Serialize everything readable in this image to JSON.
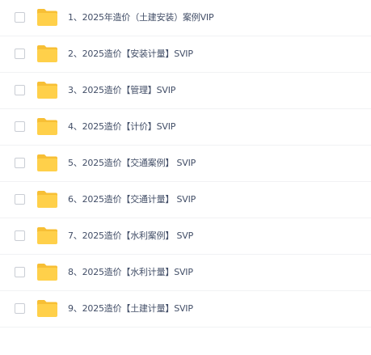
{
  "colors": {
    "folder": "#ffd04a",
    "folder_tab": "#f7bf35",
    "text": "#424e67",
    "divider": "#f1f2f4",
    "checkbox_border": "#c9cdd4"
  },
  "files": [
    {
      "name": "1、2025年造价（土建安装）案例VIP",
      "icon": "folder-icon"
    },
    {
      "name": "2、2025造价【安装计量】SVIP",
      "icon": "folder-icon"
    },
    {
      "name": "3、2025造价【管理】SVIP",
      "icon": "folder-icon"
    },
    {
      "name": "4、2025造价【计价】SVIP",
      "icon": "folder-icon"
    },
    {
      "name": "5、2025造价【交通案例】 SVIP",
      "icon": "folder-icon"
    },
    {
      "name": "6、2025造价【交通计量】 SVIP",
      "icon": "folder-icon"
    },
    {
      "name": "7、2025造价【水利案例】 SVP",
      "icon": "folder-icon"
    },
    {
      "name": "8、2025造价【水利计量】SVIP",
      "icon": "folder-icon"
    },
    {
      "name": "9、2025造价【土建计量】SVIP",
      "icon": "folder-icon"
    }
  ]
}
